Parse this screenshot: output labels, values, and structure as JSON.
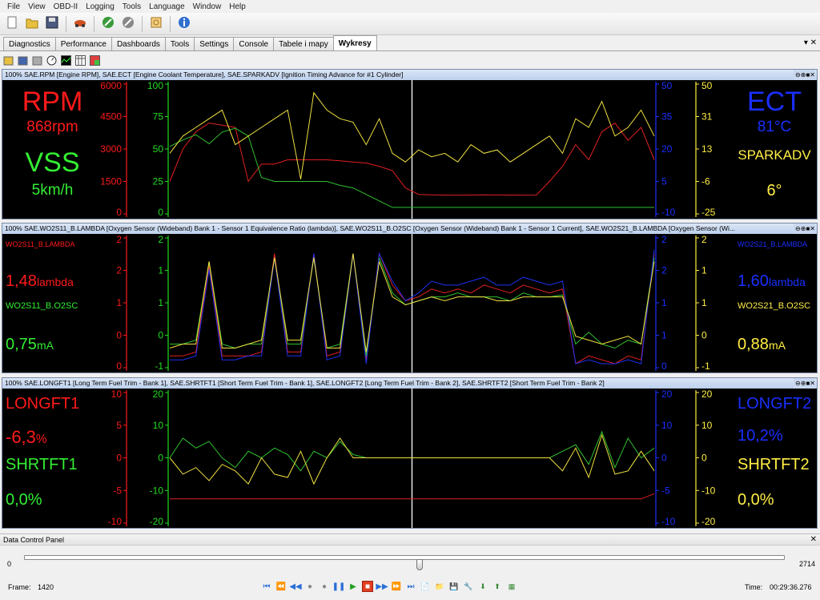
{
  "menu": [
    "File",
    "View",
    "OBD-II",
    "Logging",
    "Tools",
    "Language",
    "Window",
    "Help"
  ],
  "toolbar": [
    {
      "icon": "new-file-icon",
      "sep": false
    },
    {
      "icon": "open-folder-icon",
      "sep": false
    },
    {
      "icon": "save-icon",
      "sep": true
    },
    {
      "icon": "car-icon",
      "sep": true
    },
    {
      "icon": "connect-icon",
      "sep": false
    },
    {
      "icon": "disconnect-icon",
      "sep": true
    },
    {
      "icon": "settings-box-icon",
      "sep": true
    },
    {
      "icon": "info-icon",
      "sep": false
    }
  ],
  "tabs": [
    "Diagnostics",
    "Performance",
    "Dashboards",
    "Tools",
    "Settings",
    "Console",
    "Tabele i mapy",
    "Wykresy"
  ],
  "active_tab": "Wykresy",
  "tab_controls": "▾ ✕",
  "subtoolbar": [
    "open-icon",
    "save-icon",
    "copy-icon",
    "gauge-icon",
    "chart-icon",
    "table-icon",
    "grid-icon"
  ],
  "panel_controls": "⊖⊕■✕",
  "panels": [
    {
      "title": "100% SAE.RPM [Engine RPM], SAE.ECT [Engine Coolant Temperature], SAE.SPARKADV [Ignition Timing Advance for #1 Cylinder]",
      "left_labels": [
        {
          "text": "RPM",
          "color": "#ff1a1a",
          "size": 34
        },
        {
          "text": "868rpm",
          "color": "#ff1a1a",
          "size": 19
        },
        {
          "text": "VSS",
          "color": "#33ee33",
          "size": 34
        },
        {
          "text": "5km/h",
          "color": "#33ee33",
          "size": 19
        }
      ],
      "right_labels": [
        {
          "text": "ECT",
          "color": "#1a2fff",
          "size": 34
        },
        {
          "text": "81°C",
          "color": "#1a2fff",
          "size": 19
        },
        {
          "text": "SPARKADV",
          "color": "#ffee44",
          "size": 17
        },
        {
          "text": "6°",
          "color": "#ffee44",
          "size": 20
        }
      ],
      "axes": [
        {
          "side": "left",
          "color": "#ff1a1a",
          "ticks": [
            "6000",
            "4500",
            "3000",
            "1500",
            "0"
          ]
        },
        {
          "side": "left",
          "color": "#22dd22",
          "ticks": [
            "100",
            "75",
            "50",
            "25",
            "0"
          ]
        },
        {
          "side": "right",
          "color": "#1a2fff",
          "ticks": [
            "50",
            "35",
            "20",
            "5",
            "-10"
          ]
        },
        {
          "side": "right",
          "color": "#ffee44",
          "ticks": [
            "50",
            "31",
            "13",
            "-6",
            "-25"
          ]
        }
      ],
      "series": [
        {
          "name": "RPM",
          "color": "#e02020",
          "axis": 0,
          "values": [
            1500,
            3000,
            3800,
            4200,
            4100,
            4000,
            1500,
            2300,
            2300,
            2500,
            2500,
            2500,
            2500,
            2450,
            2400,
            2350,
            2200,
            2000,
            1200,
            900,
            880,
            870,
            868,
            870,
            880,
            875,
            870,
            868,
            870,
            1500,
            2200,
            3200,
            2500,
            3800,
            4200,
            3400,
            4000,
            2500
          ]
        },
        {
          "name": "VSS",
          "color": "#30c030",
          "axis": 1,
          "values": [
            52,
            57,
            61,
            54,
            63,
            66,
            60,
            28,
            25,
            25,
            25,
            25,
            25,
            22,
            20,
            15,
            10,
            5,
            5,
            5,
            5,
            5,
            5,
            5,
            5,
            5,
            5,
            5,
            5,
            5,
            5,
            5,
            5,
            5,
            5,
            5,
            5,
            5
          ]
        },
        {
          "name": "SPARKADV",
          "color": "#f0e040",
          "axis": 3,
          "values": [
            10,
            20,
            25,
            30,
            35,
            15,
            20,
            25,
            30,
            35,
            -5,
            45,
            35,
            30,
            28,
            15,
            30,
            10,
            5,
            12,
            8,
            10,
            5,
            15,
            10,
            12,
            5,
            10,
            15,
            20,
            10,
            30,
            25,
            40,
            20,
            25,
            35,
            20
          ]
        }
      ],
      "cursor_fraction": 0.5
    },
    {
      "title": "100% SAE.WO2S11_B.LAMBDA [Oxygen Sensor (Wideband) Bank 1 - Sensor 1 Equivalence Ratio (lambda)], SAE.WO2S11_B.O2SC [Oxygen Sensor (Wideband) Bank 1 - Sensor 1 Current], SAE.WO2S21_B.LAMBDA [Oxygen Sensor (Wi...",
      "left_labels": [
        {
          "text": "WO2S11_B.LAMBDA",
          "color": "#ff1a1a",
          "size": 9
        },
        {
          "text": "1,48",
          "unit": "lambda",
          "color": "#ff1a1a",
          "size": 20
        },
        {
          "text": "WO2S11_B.O2SC",
          "color": "#33ee33",
          "size": 11
        },
        {
          "text": "0,75",
          "unit": "mA",
          "color": "#33ee33",
          "size": 20
        }
      ],
      "right_labels": [
        {
          "text": "WO2S21_B.LAMBDA",
          "color": "#1a2fff",
          "size": 9
        },
        {
          "text": "1,60",
          "unit": "lambda",
          "color": "#1a2fff",
          "size": 20
        },
        {
          "text": "WO2S21_B.O2SC",
          "color": "#ffee44",
          "size": 11
        },
        {
          "text": "0,88",
          "unit": "mA",
          "color": "#ffee44",
          "size": 20
        }
      ],
      "axes": [
        {
          "side": "left",
          "color": "#ff1a1a",
          "ticks": [
            "2",
            "2",
            "1",
            "0",
            "0"
          ]
        },
        {
          "side": "left",
          "color": "#22dd22",
          "ticks": [
            "2",
            "1",
            "1",
            "0",
            "-1"
          ]
        },
        {
          "side": "right",
          "color": "#1a2fff",
          "ticks": [
            "2",
            "2",
            "1",
            "1",
            "0"
          ]
        },
        {
          "side": "right",
          "color": "#ffee44",
          "ticks": [
            "2",
            "1",
            "1",
            "0",
            "-1"
          ]
        }
      ],
      "series": [
        {
          "name": "WO2S11_B.LAMBDA",
          "color": "#e02020",
          "axis": 1,
          "values": [
            -0.8,
            -0.8,
            -0.7,
            1.5,
            -0.8,
            -0.8,
            -0.8,
            -0.7,
            1.8,
            -0.7,
            -0.7,
            1.8,
            -0.8,
            -0.7,
            1.8,
            -0.9,
            1.8,
            1.0,
            0.6,
            0.7,
            0.9,
            0.8,
            0.9,
            0.8,
            1.0,
            0.9,
            0.8,
            1.0,
            0.9,
            0.8,
            0.9,
            -1.0,
            -0.8,
            -0.9,
            -1.0,
            -0.8,
            -0.9,
            1.8
          ]
        },
        {
          "name": "WO2S11_B.O2SC",
          "color": "#30c030",
          "axis": 1,
          "values": [
            -0.5,
            -0.5,
            -0.4,
            1.6,
            -0.5,
            -0.6,
            -0.5,
            -0.5,
            1.7,
            -0.5,
            -0.5,
            1.7,
            -0.6,
            -0.5,
            1.8,
            -0.8,
            1.7,
            0.8,
            0.5,
            0.6,
            0.7,
            0.7,
            0.8,
            0.7,
            0.7,
            0.7,
            0.6,
            0.8,
            0.7,
            0.7,
            0.75,
            -0.5,
            -0.2,
            -0.5,
            -0.6,
            -0.4,
            -0.5,
            1.7
          ]
        },
        {
          "name": "WO2S21_B.LAMBDA",
          "color": "#2030f0",
          "axis": 1,
          "values": [
            -0.9,
            -0.9,
            -0.8,
            1.4,
            -0.9,
            -0.9,
            -0.8,
            -0.8,
            1.7,
            -0.8,
            -0.8,
            1.8,
            -0.9,
            -0.8,
            1.8,
            -1.0,
            1.8,
            1.1,
            0.6,
            0.8,
            1.1,
            1.0,
            1.0,
            1.1,
            1.2,
            1.0,
            1.0,
            1.2,
            1.1,
            1.0,
            1.1,
            -1.0,
            -0.9,
            -1.0,
            -1.0,
            -0.9,
            -1.0,
            1.9
          ]
        },
        {
          "name": "WO2S21_B.O2SC",
          "color": "#f0e040",
          "axis": 1,
          "values": [
            -0.6,
            -0.5,
            -0.5,
            1.6,
            -0.6,
            -0.6,
            -0.5,
            -0.4,
            1.7,
            -0.4,
            -0.4,
            1.7,
            -0.6,
            -0.6,
            1.8,
            -0.7,
            1.6,
            0.7,
            0.5,
            0.6,
            0.7,
            0.6,
            0.7,
            0.7,
            0.7,
            0.6,
            0.6,
            0.7,
            0.7,
            0.7,
            0.7,
            -0.3,
            -0.4,
            -0.5,
            -0.4,
            -0.3,
            -0.5,
            1.6
          ]
        }
      ],
      "y_range": [
        -1.1,
        2.2
      ],
      "cursor_fraction": 0.5
    },
    {
      "title": "100% SAE.LONGFT1 [Long Term Fuel Trim - Bank 1], SAE.SHRTFT1 [Short Term Fuel Trim - Bank 1], SAE.LONGFT2 [Long Term Fuel Trim - Bank 2], SAE.SHRTFT2 [Short Term Fuel Trim - Bank 2]",
      "left_labels": [
        {
          "text": "LONGFT1",
          "color": "#ff1a1a",
          "size": 20
        },
        {
          "text": "-6,3",
          "unit": "%",
          "color": "#ff1a1a",
          "size": 22
        },
        {
          "text": "SHRTFT1",
          "color": "#33ee33",
          "size": 20
        },
        {
          "text": "0,0%",
          "color": "#33ee33",
          "size": 20
        }
      ],
      "right_labels": [
        {
          "text": "LONGFT2",
          "color": "#1a2fff",
          "size": 20
        },
        {
          "text": "10,2%",
          "color": "#1a2fff",
          "size": 20
        },
        {
          "text": "SHRTFT2",
          "color": "#ffee44",
          "size": 20
        },
        {
          "text": "0,0%",
          "color": "#ffee44",
          "size": 20
        }
      ],
      "axes": [
        {
          "side": "left",
          "color": "#ff1a1a",
          "ticks": [
            "10",
            "5",
            "0",
            "-5",
            "-10"
          ]
        },
        {
          "side": "left",
          "color": "#22dd22",
          "ticks": [
            "20",
            "10",
            "0",
            "-10",
            "-20"
          ]
        },
        {
          "side": "right",
          "color": "#1a2fff",
          "ticks": [
            "20",
            "10",
            "0",
            "-5",
            "-10"
          ]
        },
        {
          "side": "right",
          "color": "#ffee44",
          "ticks": [
            "20",
            "10",
            "0",
            "-10",
            "-20"
          ]
        }
      ],
      "series": [
        {
          "name": "LONGFT1",
          "color": "#e02020",
          "axis": 0,
          "values": [
            -6.3,
            -6.3,
            -6.3,
            -6.3,
            -6.3,
            -6.3,
            -6.3,
            -6.3,
            -6.3,
            -6.3,
            -6.3,
            -6.3,
            -6.3,
            -6.3,
            -6.3,
            -6.3,
            -6.3,
            -6.3,
            -6.3,
            -6.3,
            -6.3,
            -6.3,
            -6.3,
            -6.3,
            -6.3,
            -6.3,
            -6.3,
            -6.3,
            -6.3,
            -6.3,
            -6.3,
            -6.3,
            -6.3,
            -6.3,
            -6.3,
            -6.3,
            -6.3,
            -5.5
          ]
        },
        {
          "name": "SHRTFT1",
          "color": "#30c030",
          "axis": 1,
          "values": [
            0,
            6,
            3,
            5,
            0,
            -3,
            2,
            0,
            3,
            1,
            -4,
            2,
            0,
            5,
            1,
            0,
            0,
            0,
            0,
            0,
            0,
            0,
            0,
            0,
            0,
            0,
            0,
            0,
            0,
            0,
            2,
            4,
            -2,
            8,
            -3,
            6,
            0,
            3
          ]
        },
        {
          "name": "SHRTFT2",
          "color": "#f0e040",
          "axis": 1,
          "values": [
            0,
            -5,
            -3,
            -7,
            -2,
            -4,
            -8,
            0,
            -5,
            -6,
            2,
            -8,
            0,
            6,
            0,
            0,
            0,
            0,
            0,
            0,
            0,
            0,
            0,
            0,
            0,
            0,
            0,
            0,
            0,
            0,
            -4,
            3,
            -6,
            7,
            -5,
            -4,
            2,
            -4
          ]
        }
      ],
      "y_range": [
        -20,
        20
      ],
      "cursor_fraction": 0.5
    }
  ],
  "data_control_panel": {
    "title": "Data Control Panel",
    "close": "✕",
    "min": "0",
    "max": "2714",
    "frame_label": "Frame:",
    "frame_value": "1420",
    "time_label": "Time:",
    "time_value": "00:29:36.276",
    "position_fraction": 0.52,
    "buttons": [
      "⏮",
      "⏪",
      "◀◀",
      "●",
      "●",
      "❚❚",
      "▶",
      "■",
      "▶▶",
      "⏩",
      "⏭",
      "📄",
      "📁",
      "💾",
      "🔧",
      "⬇",
      "⬆",
      "▦"
    ]
  }
}
